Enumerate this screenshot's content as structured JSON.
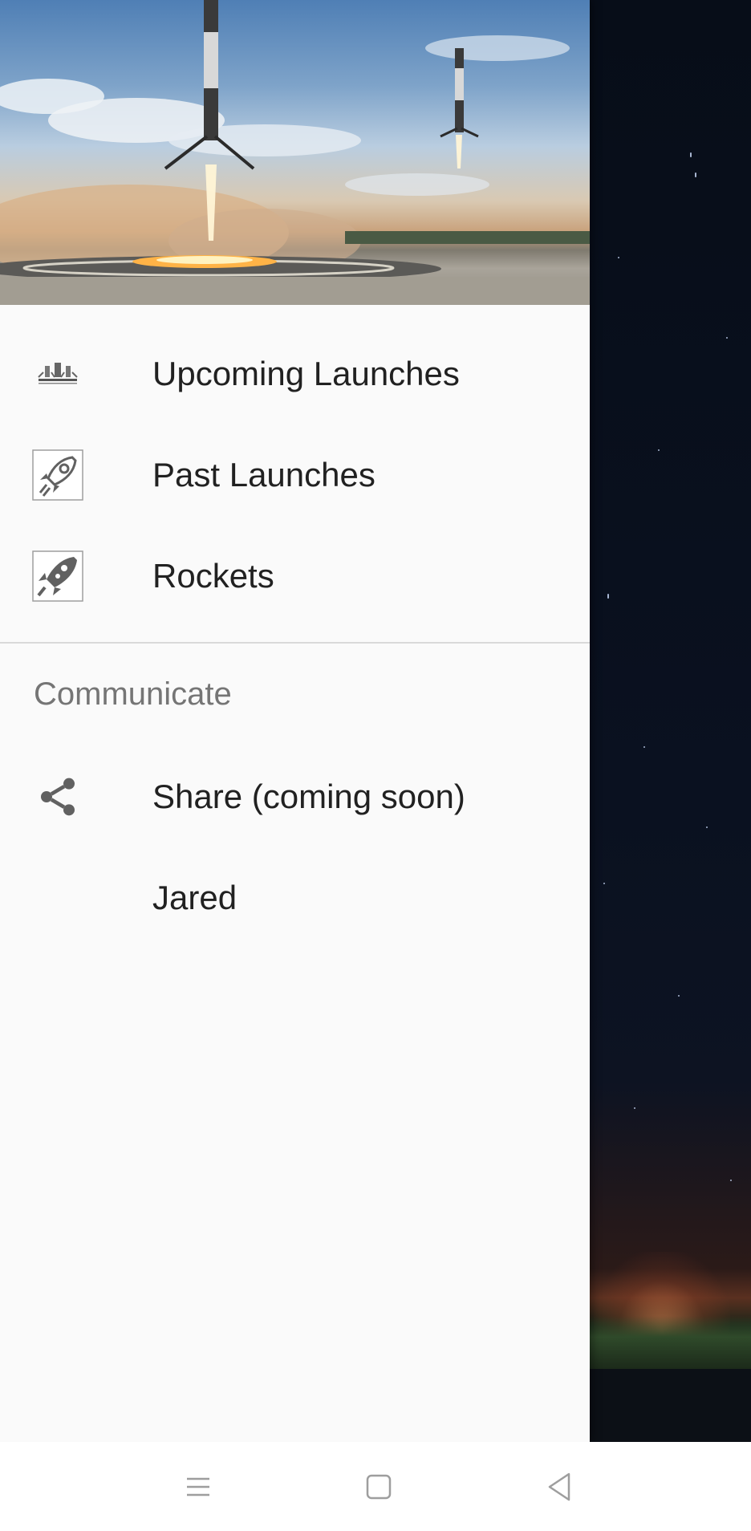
{
  "drawer": {
    "header_image": "falcon-heavy-booster-landing",
    "menu": [
      {
        "label": "Upcoming Launches",
        "icon": "falcon-heavy-icon"
      },
      {
        "label": "Past Launches",
        "icon": "rocket-outline-icon"
      },
      {
        "label": "Rockets",
        "icon": "rocket-solid-icon"
      }
    ],
    "section": {
      "title": "Communicate",
      "items": [
        {
          "label": "Share (coming soon)",
          "icon": "share-icon"
        },
        {
          "label": "Jared",
          "icon": ""
        }
      ]
    }
  },
  "background": {
    "image": "night-sky-launch-site"
  },
  "nav_bar": {
    "buttons": [
      "menu-icon",
      "home-square-icon",
      "back-triangle-icon"
    ]
  },
  "colors": {
    "drawer_bg": "#fafafa",
    "text_primary": "#212121",
    "text_secondary": "#757575",
    "icon_gray": "#757575"
  }
}
